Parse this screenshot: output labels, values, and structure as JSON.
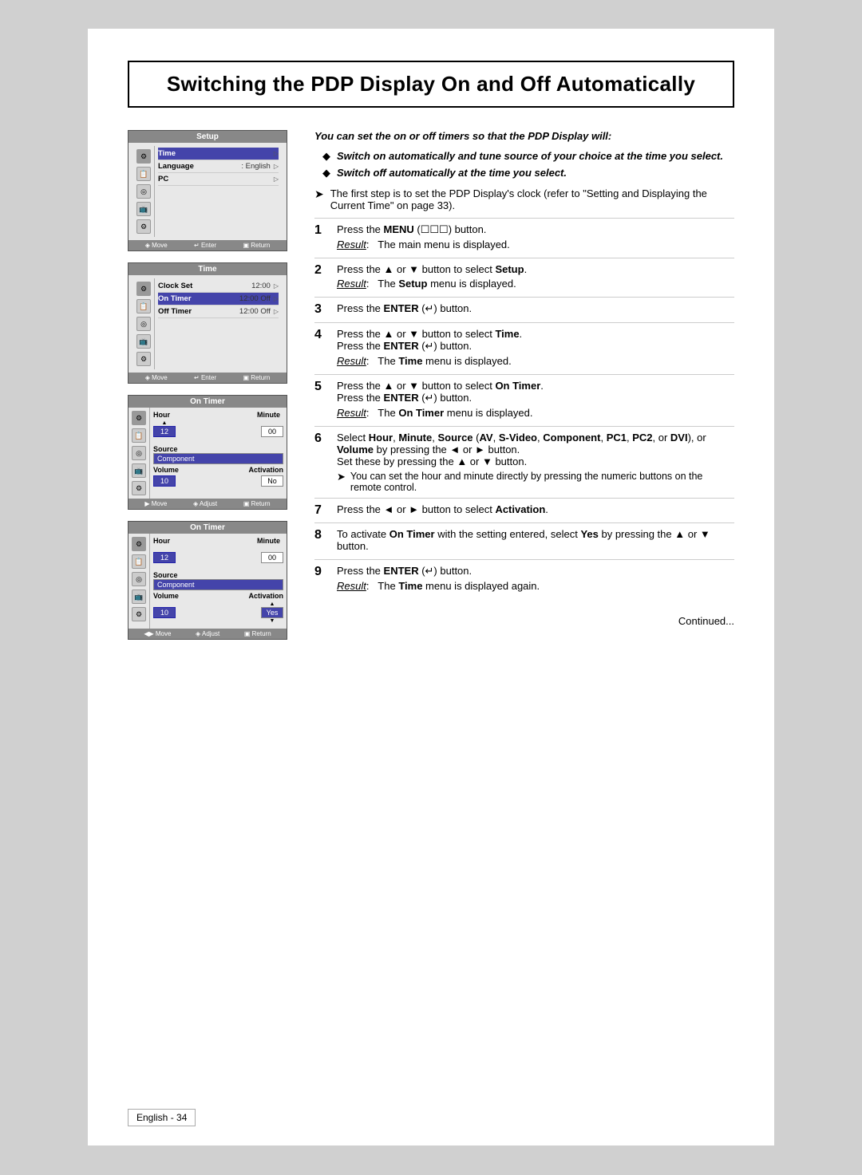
{
  "page": {
    "title": "Switching the PDP Display On and Off Automatically",
    "footer": "English - 34"
  },
  "intro": {
    "text": "You can set the on or off timers so that the PDP Display will:"
  },
  "bullets": [
    {
      "text": "Switch on automatically and tune source of your choice at the time you select."
    },
    {
      "text": "Switch off automatically at the time you select."
    }
  ],
  "note": "The first step is to set the PDP Display's clock (refer to \"Setting and Displaying the Current Time\" on page 33).",
  "steps": [
    {
      "num": "1",
      "instruction": "Press the MENU (   ) button.",
      "result": "The main menu is displayed."
    },
    {
      "num": "2",
      "instruction": "Press the ▲ or ▼ button to select Setup.",
      "result": "The Setup menu is displayed."
    },
    {
      "num": "3",
      "instruction": "Press the ENTER (  ) button.",
      "result": ""
    },
    {
      "num": "4",
      "instruction": "Press the ▲ or ▼ button to select Time. Press the ENTER (  ) button.",
      "result": "The Time menu is displayed."
    },
    {
      "num": "5",
      "instruction": "Press the ▲ or ▼ button to select On Timer. Press the ENTER (  ) button.",
      "result": "The On Timer menu is displayed."
    },
    {
      "num": "6",
      "instruction": "Select Hour, Minute, Source (AV, S-Video, Component, PC1, PC2, or DVI), or Volume by pressing the ◄ or ► button. Set these by pressing the ▲ or ▼ button.",
      "subnote": "You can set the hour and minute directly by pressing the numeric buttons on the remote control."
    },
    {
      "num": "7",
      "instruction": "Press the ◄ or ► button to select Activation."
    },
    {
      "num": "8",
      "instruction": "To activate On Timer with the setting entered, select Yes by pressing the ▲ or ▼ button."
    },
    {
      "num": "9",
      "instruction": "Press the ENTER (  ) button.",
      "result": "The Time menu is displayed again."
    }
  ],
  "continued": "Continued...",
  "screens": {
    "setup": {
      "title": "Setup",
      "rows": [
        {
          "label": "Time",
          "value": "",
          "arrow": "▷"
        },
        {
          "label": "Language",
          "value": ": English",
          "arrow": "▷"
        },
        {
          "label": "PC",
          "value": "",
          "arrow": "▷"
        }
      ],
      "footer": [
        "◈ Move",
        "↵ Enter",
        "▣ Return"
      ]
    },
    "time": {
      "title": "Time",
      "rows": [
        {
          "label": "Clock Set",
          "value": "12:00",
          "arrow": "▷"
        },
        {
          "label": "On Timer",
          "value": "12:00  Off",
          "arrow": "▷",
          "highlight": true
        },
        {
          "label": "Off Timer",
          "value": "12:00  Off",
          "arrow": "▷"
        }
      ],
      "footer": [
        "◈ Move",
        "↵ Enter",
        "▣ Return"
      ]
    },
    "onTimer1": {
      "title": "On Timer",
      "hour": "12",
      "minute": "00",
      "source": "Component",
      "volume": "10",
      "activation": "No",
      "footer": [
        "▶ Move",
        "◈ Adjust",
        "▣ Return"
      ]
    },
    "onTimer2": {
      "title": "On Timer",
      "hour": "12",
      "minute": "00",
      "source": "Component",
      "volume": "10",
      "activation": "Yes",
      "footer": [
        "◀▶ Move",
        "◈ Adjust",
        "▣ Return"
      ]
    }
  }
}
